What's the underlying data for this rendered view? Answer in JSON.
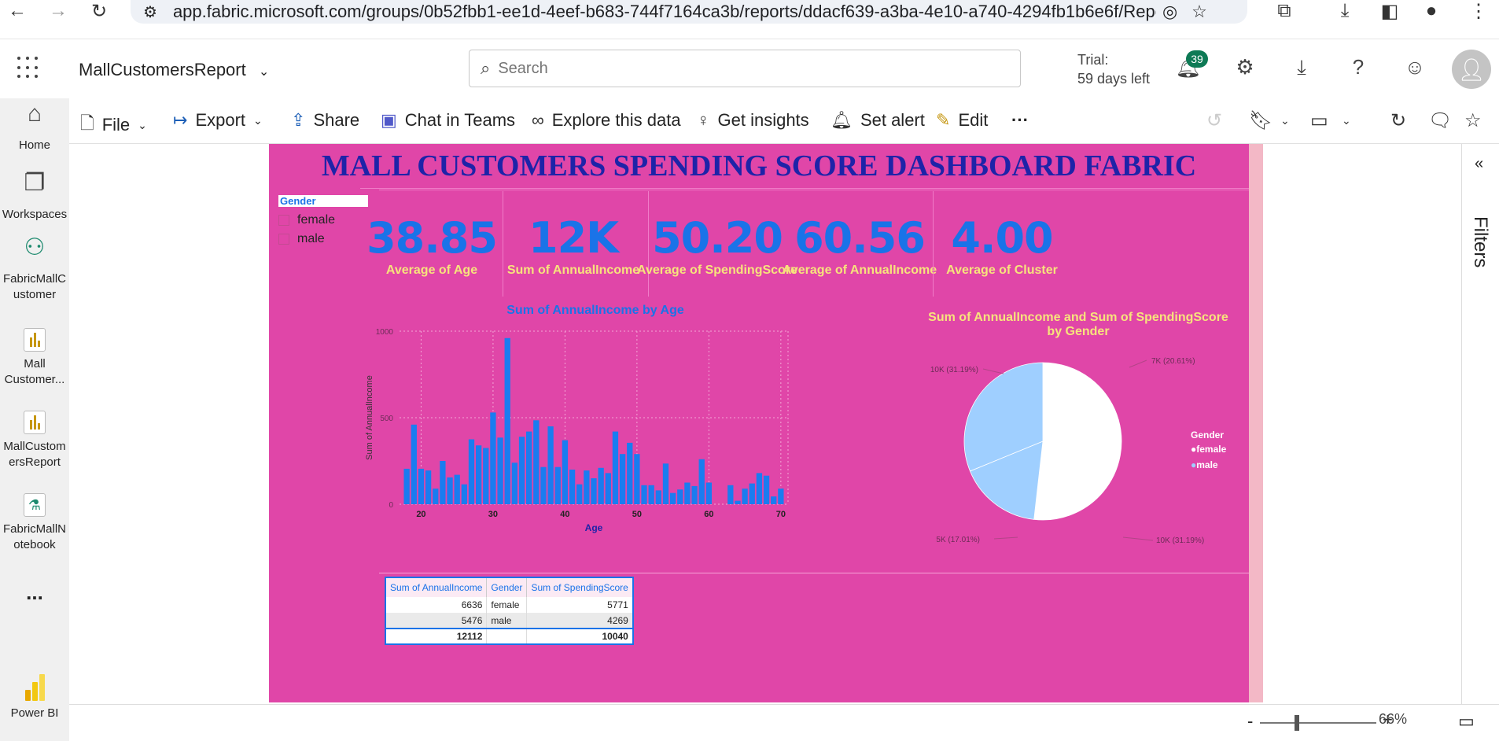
{
  "browser": {
    "url": "app.fabric.microsoft.com/groups/0b52fbb1-ee1d-4eef-b683-744f7164ca3b/reports/ddacf639-a3ba-4e10-a740-4294fb1b6e6f/ReportS..."
  },
  "header": {
    "report_name": "MallCustomersReport",
    "search_placeholder": "Search",
    "trial_line1": "Trial:",
    "trial_line2": "59 days left",
    "notification_count": "39"
  },
  "rail": {
    "items": [
      {
        "label": "Home"
      },
      {
        "label": "Workspaces"
      },
      {
        "label": "FabricMallC ustomer"
      },
      {
        "label": "Mall Customer..."
      },
      {
        "label": "MallCustom ersReport"
      },
      {
        "label": "FabricMallN otebook"
      },
      {
        "label": "..."
      },
      {
        "label": "Power BI"
      }
    ]
  },
  "toolbar": {
    "file": "File",
    "export": "Export",
    "share": "Share",
    "chat_in_teams": "Chat in Teams",
    "explore": "Explore this data",
    "insights": "Get insights",
    "alert": "Set alert",
    "edit": "Edit",
    "more": "···"
  },
  "filters": {
    "label": "Filters"
  },
  "zoom": {
    "level": "66%"
  },
  "report": {
    "title": "MALL CUSTOMERS SPENDING SCORE DASHBOARD FABRIC",
    "slicer": {
      "title": "Gender",
      "options": [
        "female",
        "male"
      ]
    },
    "kpis": [
      {
        "value": "38.85",
        "label": "Average of Age"
      },
      {
        "value": "12K",
        "label": "Sum of AnnualIncome"
      },
      {
        "value": "50.20",
        "label": "Average of SpendingScore"
      },
      {
        "value": "60.56",
        "label": "Average of AnnualIncome"
      },
      {
        "value": "4.00",
        "label": "Average of Cluster"
      }
    ],
    "table": {
      "headers": [
        "Sum of AnnualIncome",
        "Gender",
        "Sum of SpendingScore"
      ],
      "rows": [
        [
          "6636",
          "female",
          "5771"
        ],
        [
          "5476",
          "male",
          "4269"
        ]
      ],
      "total": [
        "12112",
        "",
        "10040"
      ]
    },
    "colors": {
      "background": "#e046a8",
      "title": "#1e23a8",
      "accent": "#1a73e8",
      "kpi_label": "#f7e37c"
    }
  },
  "chart_data": [
    {
      "type": "bar",
      "title": "Sum of AnnualIncome by Age",
      "xlabel": "Age",
      "ylabel": "Sum of AnnualIncome",
      "xlim": [
        17,
        71
      ],
      "ylim": [
        0,
        1000
      ],
      "yticks": [
        0,
        500,
        1000
      ],
      "xticks": [
        20,
        30,
        40,
        50,
        60,
        70
      ],
      "grid": true,
      "x": [
        18,
        19,
        20,
        21,
        22,
        23,
        24,
        25,
        26,
        27,
        28,
        29,
        30,
        31,
        32,
        33,
        34,
        35,
        36,
        37,
        38,
        39,
        40,
        41,
        42,
        43,
        44,
        45,
        46,
        47,
        48,
        49,
        50,
        51,
        52,
        53,
        54,
        55,
        56,
        57,
        58,
        59,
        60,
        63,
        64,
        65,
        66,
        67,
        68,
        69,
        70
      ],
      "values": [
        205,
        460,
        205,
        195,
        90,
        250,
        155,
        170,
        115,
        375,
        340,
        325,
        530,
        385,
        960,
        240,
        390,
        420,
        485,
        215,
        450,
        215,
        370,
        200,
        115,
        195,
        150,
        210,
        180,
        420,
        290,
        355,
        290,
        110,
        110,
        80,
        235,
        65,
        85,
        125,
        105,
        260,
        125,
        110,
        20,
        90,
        120,
        180,
        165,
        45,
        90
      ]
    },
    {
      "type": "pie",
      "title": "Sum of AnnualIncome and Sum of SpendingScore by Gender",
      "legend_title": "Gender",
      "legend": [
        "female",
        "male"
      ],
      "legend_position": "right",
      "slices": [
        {
          "label": "7K (20.61%)",
          "value": 20.61,
          "color": "#ffffff"
        },
        {
          "label": "10K (31.19%)",
          "value": 31.19,
          "color": "#ffffff"
        },
        {
          "label": "5K (17.01%)",
          "value": 17.01,
          "color": "#9fcfff"
        },
        {
          "label": "10K (31.19%)",
          "value": 31.19,
          "color": "#9fcfff"
        }
      ]
    }
  ]
}
